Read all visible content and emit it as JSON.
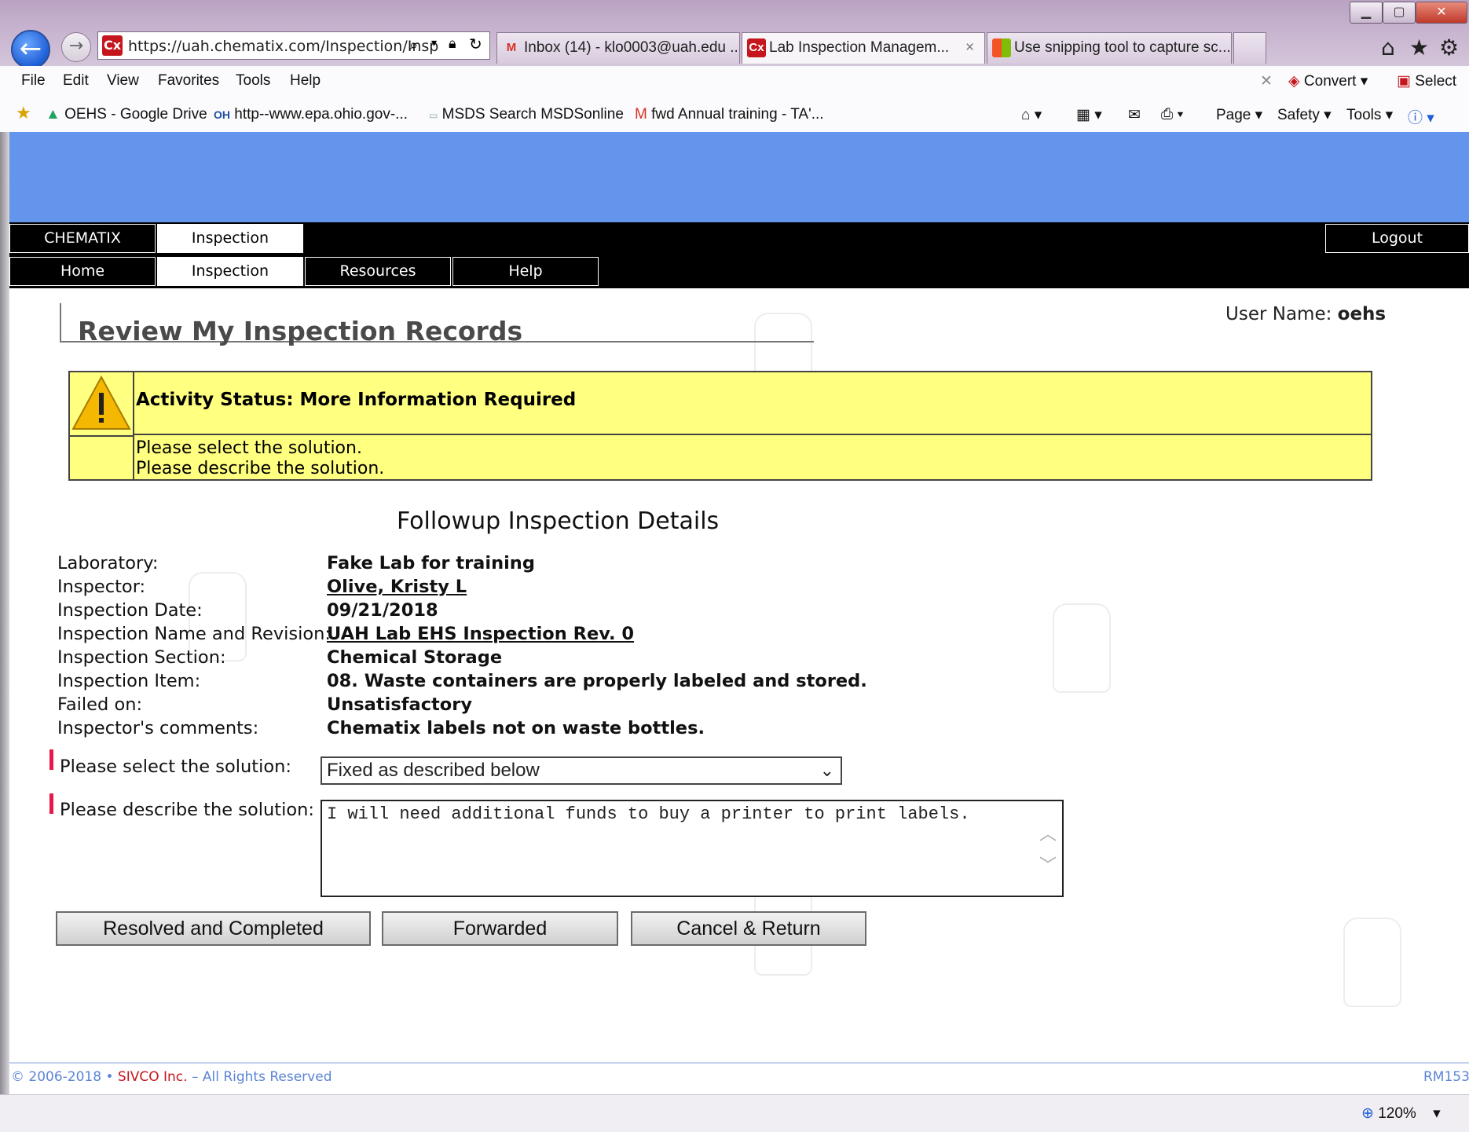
{
  "browser": {
    "url": "https://uah.chematix.com/Inspection/Insp",
    "tabs": [
      {
        "label": "Inbox (14) - klo0003@uah.edu ...",
        "icon": "gmail-icon"
      },
      {
        "label": "Lab Inspection Managem...",
        "icon": "chematix-icon",
        "active": true
      },
      {
        "label": "Use snipping tool to capture sc...",
        "icon": "windows-icon"
      }
    ],
    "tab_close": "×",
    "menu": [
      "File",
      "Edit",
      "View",
      "Favorites",
      "Tools",
      "Help"
    ],
    "convert": "Convert",
    "select": "Select",
    "favorites": [
      "OEHS - Google Drive",
      "http--www.epa.ohio.gov-...",
      "MSDS Search MSDSonline",
      "fwd Annual training - TA'..."
    ],
    "cmd": [
      "Page",
      "Safety",
      "Tools"
    ],
    "zoom": "120%"
  },
  "nav": {
    "row1": {
      "app": "CHEMATIX",
      "section": "Inspection",
      "logout": "Logout"
    },
    "row2": [
      "Home",
      "Inspection",
      "Resources",
      "Help"
    ]
  },
  "page": {
    "title": "Review My Inspection Records",
    "user_label": "User Name:",
    "user_value": "oehs"
  },
  "status": {
    "title": "Activity Status: More Information Required",
    "messages": [
      "Please select the solution.",
      "Please describe the solution."
    ]
  },
  "details": {
    "heading": "Followup Inspection Details",
    "rows": [
      {
        "label": "Laboratory:",
        "value": "Fake Lab for training"
      },
      {
        "label": "Inspector:",
        "value": "Olive, Kristy L"
      },
      {
        "label": "Inspection Date:",
        "value": "09/21/2018"
      },
      {
        "label": "Inspection Name and Revision:",
        "value": "UAH Lab EHS Inspection Rev. 0"
      },
      {
        "label": "Inspection Section:",
        "value": "Chemical Storage"
      },
      {
        "label": "Inspection Item:",
        "value": "08. Waste containers are properly labeled and stored."
      },
      {
        "label": "Failed on:",
        "value": "Unsatisfactory"
      },
      {
        "label": "Inspector's comments:",
        "value": "Chematix labels not on waste bottles."
      }
    ]
  },
  "form": {
    "select_label": "Please select the solution:",
    "select_value": "Fixed as described below",
    "describe_label": "Please describe the solution:",
    "describe_value": "I will need additional funds to buy a printer to print labels."
  },
  "buttons": {
    "resolved": "Resolved and Completed",
    "forwarded": "Forwarded",
    "cancel": "Cancel & Return"
  },
  "footer": {
    "copyright_years": "© 2006-2018 •",
    "company": "SIVCO Inc.",
    "rights": "– All Rights Reserved",
    "code": "RM153"
  },
  "colors": {
    "band": "#6495ed",
    "status_bg": "#ffff80",
    "required_marker": "#e8174a"
  }
}
